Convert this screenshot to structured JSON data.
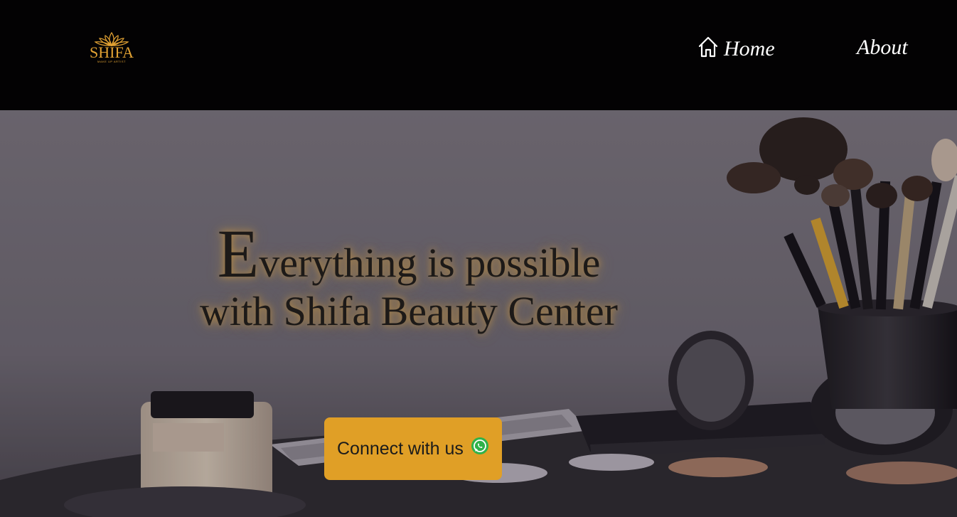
{
  "brand": {
    "name": "SHIFA",
    "tagline": "MAKE UP ARTIST",
    "accent_color": "#e2a233"
  },
  "nav": {
    "items": [
      {
        "label": "Home",
        "icon": "home-icon"
      },
      {
        "label": "About"
      }
    ]
  },
  "hero": {
    "headline_initial": "E",
    "headline_line1_rest": "verything is possible",
    "headline_line2": "with Shifa Beauty Center",
    "cta_label": "Connect with us",
    "cta_icon": "whatsapp-icon",
    "cta_color": "#e09f26",
    "background": "makeup-brushes-photo"
  }
}
